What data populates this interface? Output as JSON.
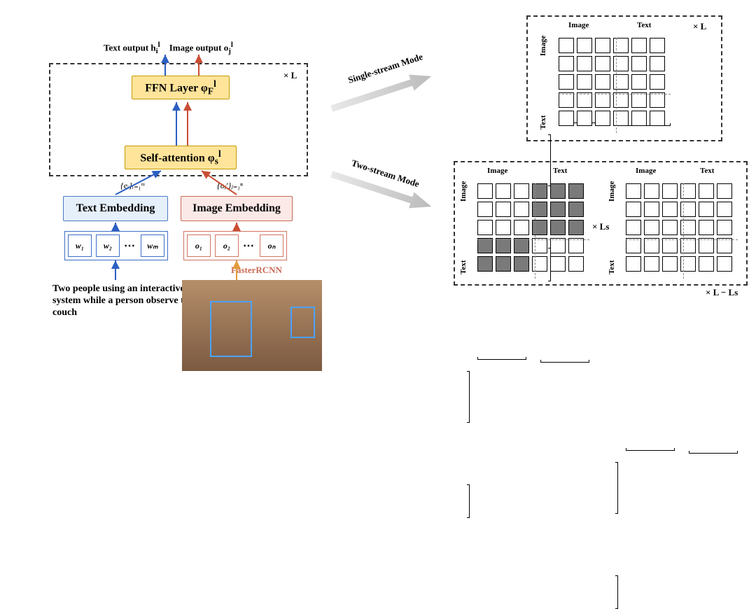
{
  "left": {
    "text_output_label": "Text output h",
    "text_output_sub": "i",
    "text_output_sup": "l",
    "image_output_label": "Image output o",
    "image_output_sub": "j",
    "image_output_sup": "l",
    "ffn_label": "FFN Layer φ",
    "ffn_sub": "F",
    "ffn_sup": "l",
    "sa_label": "Self-attention φ",
    "sa_sub": "s",
    "sa_sup": "l",
    "text_embedding_label": "Text Embedding",
    "image_embedding_label": "Image Embedding",
    "text_tokens": [
      "w₁",
      "w₂",
      "…",
      "wₘ"
    ],
    "image_tokens": [
      "o₁",
      "o₂",
      "…",
      "oₙ"
    ],
    "text_seq_label": "{eᵢ}ᵢ₌₁ᵐ",
    "image_seq_label": "{oⱼ′}ⱼ₌₁ⁿ",
    "times_L": "× L",
    "caption_text": "Two people using an interactive gaming system while a person observe them from a couch",
    "detector_label": "FasterRCNN"
  },
  "right": {
    "mode_single": "Single-stream Mode",
    "mode_two": "Two-stream Mode",
    "axis_image": "Image",
    "axis_text": "Text",
    "times_L": "× L",
    "times_Ls": "× Ls",
    "times_L_minus_Ls": "× L − Ls"
  }
}
